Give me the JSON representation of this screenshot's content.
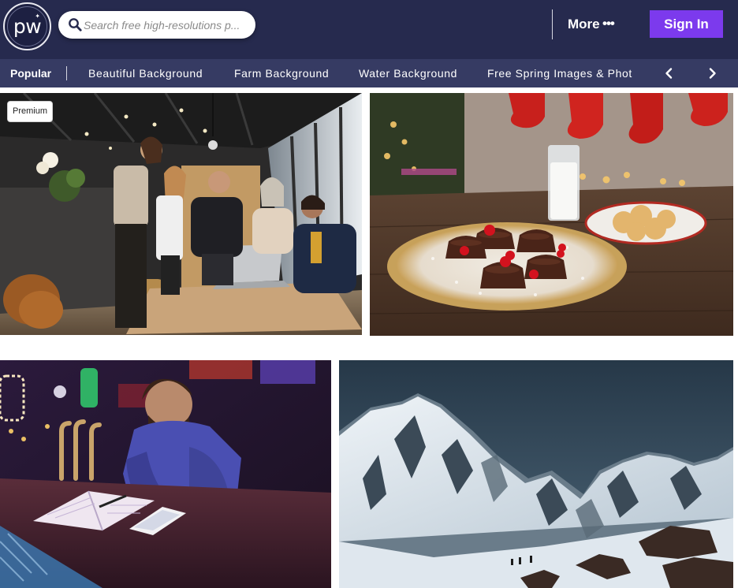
{
  "brand": {
    "logo_text": "pw"
  },
  "search": {
    "placeholder": "Search free high-resolutions p..."
  },
  "header": {
    "more_label": "More",
    "more_dots": "•••",
    "signin_label": "Sign In",
    "accent_color": "#7c3aed"
  },
  "categories": {
    "popular_label": "Popular",
    "items": [
      "Beautiful Background",
      "Farm Background",
      "Water Background",
      "Free Spring Images & Phot"
    ]
  },
  "photos": [
    {
      "subject": "office team meeting around laptop",
      "badge": "Premium"
    },
    {
      "subject": "chocolate cakes with berries and glass of milk"
    },
    {
      "subject": "man reading tablet at bar counter"
    },
    {
      "subject": "snowy mountain range under night sky"
    }
  ],
  "icons": [
    "search-icon",
    "chevron-left-icon",
    "chevron-right-icon"
  ]
}
